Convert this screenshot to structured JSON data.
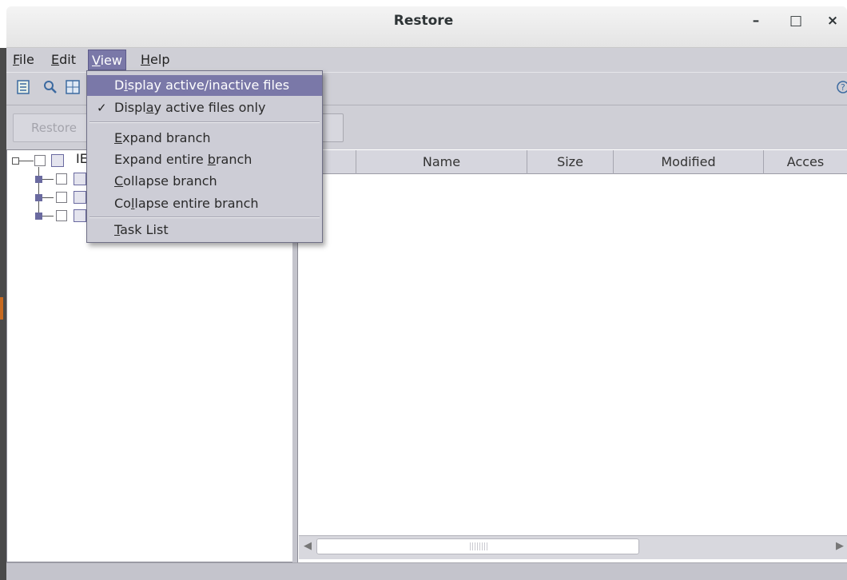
{
  "window": {
    "title": "Restore",
    "minimize": "–",
    "maximize": "□",
    "close": "×"
  },
  "menubar": {
    "file": {
      "prefix": "",
      "mnemonic": "F",
      "rest": "ile"
    },
    "edit": {
      "prefix": "",
      "mnemonic": "E",
      "rest": "dit"
    },
    "view": {
      "prefix": "",
      "mnemonic": "V",
      "rest": "iew"
    },
    "help": {
      "prefix": "",
      "mnemonic": "H",
      "rest": "elp"
    }
  },
  "toolbar": {
    "restore_label": "Restore",
    "icons": [
      "list-icon",
      "search-icon",
      "grid-icon",
      "help-icon"
    ]
  },
  "view_menu": {
    "items": [
      {
        "prefix": "D",
        "mnemonic": "i",
        "rest": "splay active/inactive files",
        "highlighted": true,
        "checked": false
      },
      {
        "prefix": "Displ",
        "mnemonic": "a",
        "rest": "y active files only",
        "highlighted": false,
        "checked": true
      },
      {
        "prefix": "",
        "mnemonic": "E",
        "rest": "xpand branch"
      },
      {
        "prefix": "Expand entire ",
        "mnemonic": "b",
        "rest": "ranch"
      },
      {
        "prefix": "",
        "mnemonic": "C",
        "rest": "ollapse branch"
      },
      {
        "prefix": "Co",
        "mnemonic": "l",
        "rest": "lapse entire branch"
      },
      {
        "prefix": "",
        "mnemonic": "T",
        "rest": "ask List"
      }
    ],
    "check_mark": "✓"
  },
  "tree": {
    "root_label": "IE"
  },
  "file_table": {
    "columns": [
      "Name",
      "Size",
      "Modified",
      "Acces"
    ]
  },
  "colors": {
    "menu_highlight": "#7a78a8",
    "chrome": "#cfcfd6"
  }
}
